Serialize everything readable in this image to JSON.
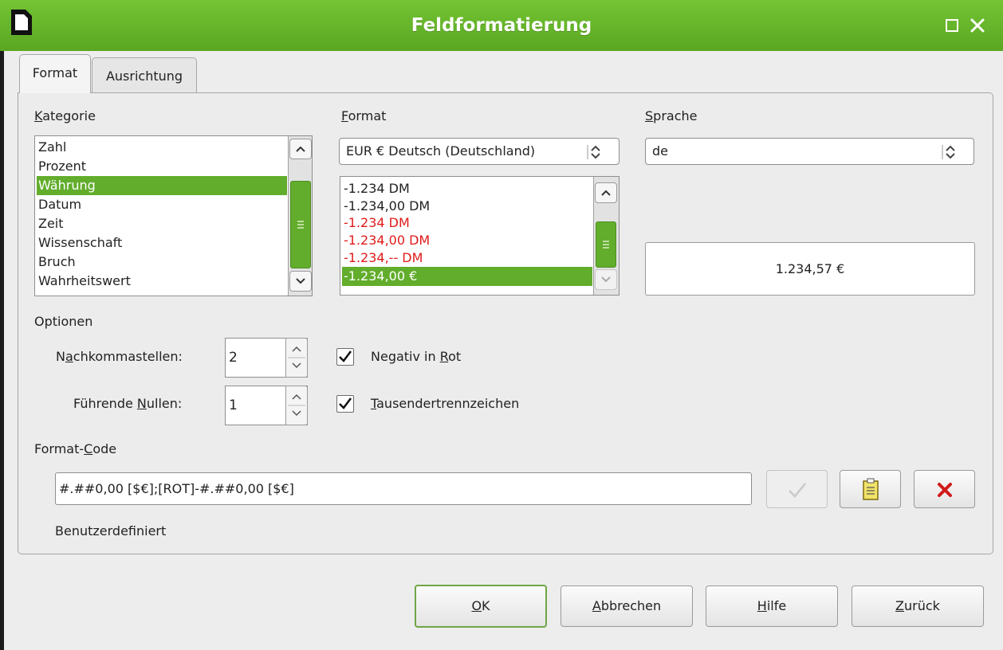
{
  "window": {
    "title": "Feldformatierung",
    "accent_color": "#5aa722",
    "icons": {
      "app": "document-icon",
      "maximize": "maximize-icon",
      "close": "close-icon"
    }
  },
  "tabs": [
    {
      "label": "Format",
      "active": true
    },
    {
      "label": "Ausrichtung",
      "active": false
    }
  ],
  "category": {
    "label_accel": "K",
    "label_rest": "ategorie",
    "items": [
      "Zahl",
      "Prozent",
      "Währung",
      "Datum",
      "Zeit",
      "Wissenschaft",
      "Bruch",
      "Wahrheitswert"
    ],
    "selected": "Währung"
  },
  "format": {
    "label_accel": "F",
    "label_rest": "ormat",
    "currency_select": "EUR  € Deutsch (Deutschland)",
    "items": [
      "-1.234 DM",
      "-1.234,00 DM",
      "-1.234 DM",
      "-1.234,00 DM",
      "-1.234,-- DM",
      "-1.234,00 €"
    ],
    "negative_color": "#e01b1b",
    "selected": "-1.234,00 €"
  },
  "language": {
    "label_accel": "S",
    "label_rest": "prache",
    "value": "de"
  },
  "preview": {
    "value": "1.234,57 €"
  },
  "options": {
    "heading": "Optionen",
    "decimal_label_a": "N",
    "decimal_label_accel": "a",
    "decimal_label_b": "chkommastellen:",
    "decimal_places": "2",
    "leading_label_a": "Führende ",
    "leading_label_accel": "N",
    "leading_label_b": "ullen:",
    "leading_zeros": "1",
    "negative_red_a": "Negativ in ",
    "negative_red_accel": "R",
    "negative_red_b": "ot",
    "negative_red_checked": true,
    "thousands_accel": "T",
    "thousands_rest": "ausendertrennzeichen",
    "thousands_checked": true
  },
  "format_code": {
    "label_a": "Format-",
    "label_accel": "C",
    "label_b": "ode",
    "value": "#.##0,00 [$€];[ROT]-#.##0,00 [$€]",
    "description": "Benutzerdefiniert",
    "icons": {
      "accept": "checkmark-icon",
      "comment": "note-icon",
      "delete": "delete-icon"
    }
  },
  "buttons": {
    "ok_accel": "O",
    "ok_rest": "K",
    "cancel_accel": "A",
    "cancel_rest": "bbrechen",
    "help_accel": "H",
    "help_rest": "ilfe",
    "back_accel": "Z",
    "back_rest": "urück"
  }
}
